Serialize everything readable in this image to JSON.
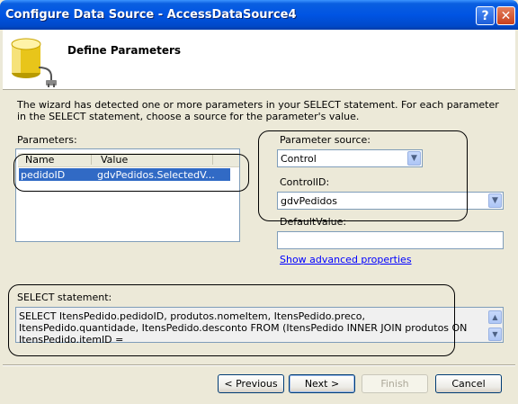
{
  "window": {
    "title": "Configure Data Source - AccessDataSource4"
  },
  "titlebar": {
    "help_glyph": "?",
    "close_glyph": "✕"
  },
  "header": {
    "title": "Define Parameters",
    "icon": "database-plug-icon"
  },
  "description": "The wizard has detected one or more parameters in your SELECT statement. For each parameter in the SELECT statement, choose a source for the parameter's value.",
  "parameters": {
    "label": "Parameters:",
    "columns": [
      "Name",
      "Value"
    ],
    "rows": [
      {
        "name": "pedidoID",
        "value": "gdvPedidos.SelectedV..."
      }
    ]
  },
  "parameter_source": {
    "label": "Parameter source:",
    "value": "Control"
  },
  "control_id": {
    "label": "ControlID:",
    "value": "gdvPedidos"
  },
  "default_value": {
    "label": "DefaultValue:",
    "value": ""
  },
  "advanced_link": "Show advanced properties",
  "select_statement": {
    "label": "SELECT statement:",
    "text": "SELECT ItensPedido.pedidoID, produtos.nomeItem, ItensPedido.preco, ItensPedido.quantidade, ItensPedido.desconto FROM (ItensPedido INNER JOIN produtos ON ItensPedido.itemID ="
  },
  "buttons": {
    "previous": "< Previous",
    "next": "Next >",
    "finish": "Finish",
    "cancel": "Cancel"
  },
  "glyphs": {
    "dropdown": "▼",
    "scroll_up": "▲",
    "scroll_down": "▼"
  },
  "colors": {
    "title_bar": "#0054e3",
    "selection": "#316ac5",
    "link": "#0000ff",
    "dialog_bg": "#ece9d8"
  }
}
